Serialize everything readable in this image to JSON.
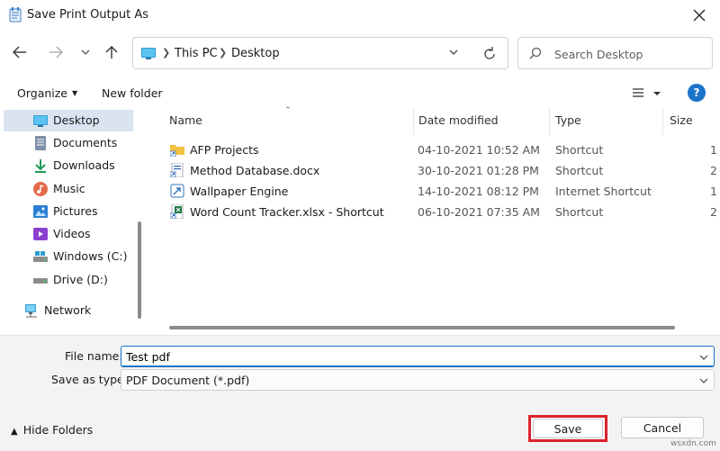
{
  "window": {
    "title": "Save Print Output As"
  },
  "nav": {
    "breadcrumbs": [
      "This PC",
      "Desktop"
    ],
    "search_placeholder": "Search Desktop"
  },
  "toolbar": {
    "organize_label": "Organize",
    "new_folder_label": "New folder",
    "help_label": "?"
  },
  "sidebar": {
    "items": [
      {
        "label": "Desktop",
        "icon": "desktop-icon",
        "selected": true
      },
      {
        "label": "Documents",
        "icon": "documents-icon"
      },
      {
        "label": "Downloads",
        "icon": "downloads-icon"
      },
      {
        "label": "Music",
        "icon": "music-icon"
      },
      {
        "label": "Pictures",
        "icon": "pictures-icon"
      },
      {
        "label": "Videos",
        "icon": "videos-icon"
      },
      {
        "label": "Windows (C:)",
        "icon": "drive-c-icon"
      },
      {
        "label": "Drive (D:)",
        "icon": "drive-d-icon"
      },
      {
        "label": "Network",
        "icon": "network-icon"
      }
    ]
  },
  "files": {
    "columns": [
      "Name",
      "Date modified",
      "Type",
      "Size"
    ],
    "rows": [
      {
        "name": "AFP Projects",
        "date": "04-10-2021 10:52 AM",
        "type": "Shortcut",
        "size": "1",
        "icon": "folder-shortcut-icon"
      },
      {
        "name": "Method Database.docx",
        "date": "30-10-2021 01:28 PM",
        "type": "Shortcut",
        "size": "2",
        "icon": "docx-shortcut-icon"
      },
      {
        "name": "Wallpaper Engine",
        "date": "14-10-2021 08:12 PM",
        "type": "Internet Shortcut",
        "size": "1",
        "icon": "internet-shortcut-icon"
      },
      {
        "name": "Word Count Tracker.xlsx - Shortcut",
        "date": "06-10-2021 07:35 AM",
        "type": "Shortcut",
        "size": "2",
        "icon": "xlsx-shortcut-icon"
      }
    ]
  },
  "form": {
    "file_name_label": "File name:",
    "file_name_value": "Test pdf",
    "save_type_label": "Save as type:",
    "save_type_value": "PDF Document (*.pdf)"
  },
  "footer": {
    "hide_folders_label": "Hide Folders",
    "save_label": "Save",
    "cancel_label": "Cancel",
    "watermark": "wsxdn.com"
  },
  "colors": {
    "accent": "#1a73c8",
    "highlight_border": "#d9232d",
    "selected_bg": "#d9e4f0"
  }
}
